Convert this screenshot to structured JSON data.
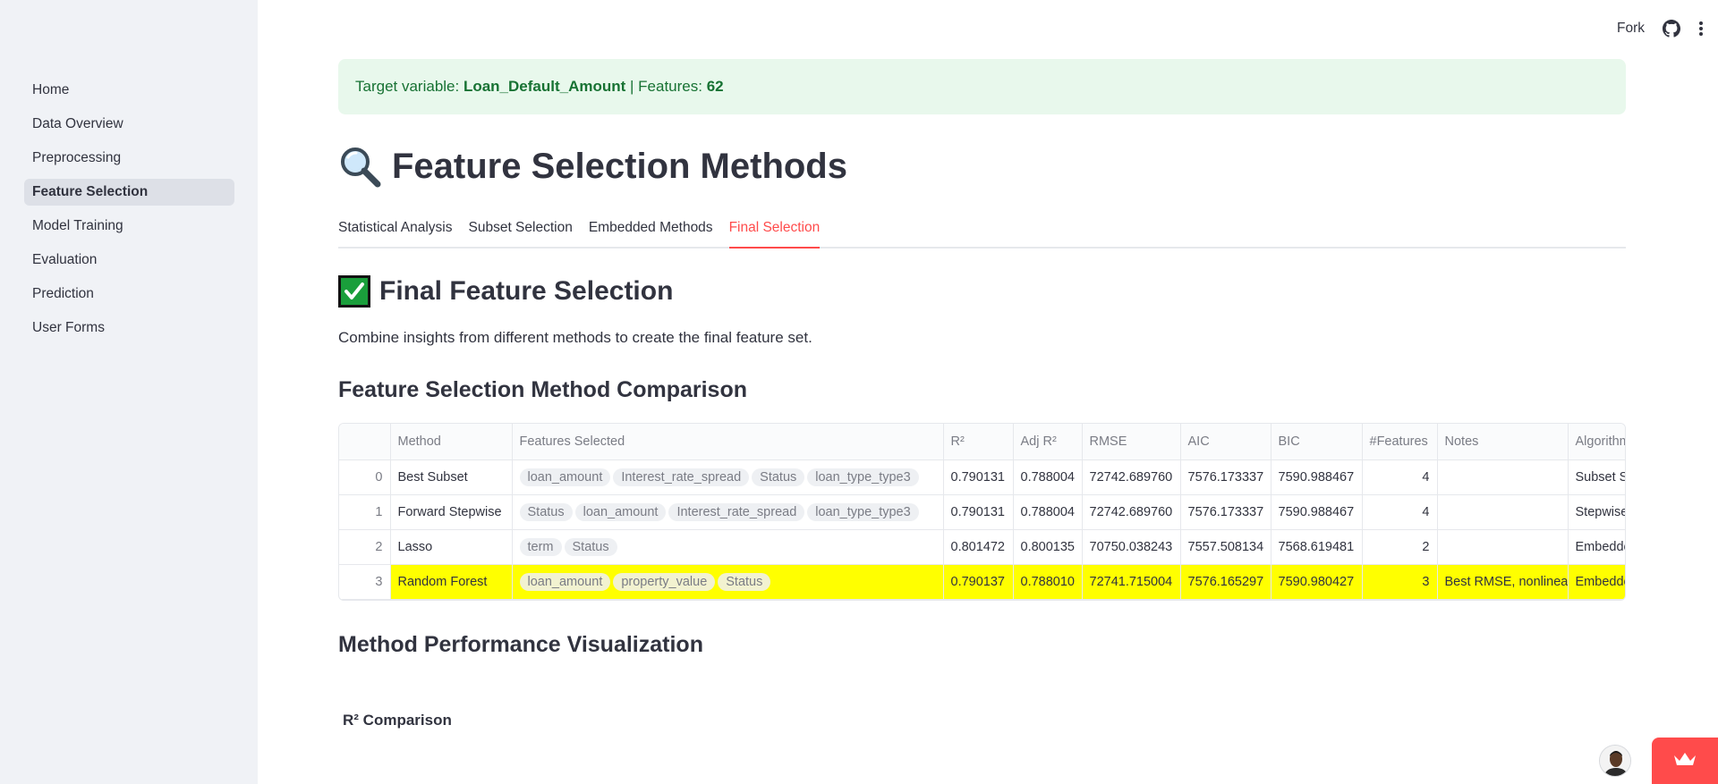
{
  "sidebar": {
    "items": [
      {
        "label": "Home",
        "active": false
      },
      {
        "label": "Data Overview",
        "active": false
      },
      {
        "label": "Preprocessing",
        "active": false
      },
      {
        "label": "Feature Selection",
        "active": true
      },
      {
        "label": "Model Training",
        "active": false
      },
      {
        "label": "Evaluation",
        "active": false
      },
      {
        "label": "Prediction",
        "active": false
      },
      {
        "label": "User Forms",
        "active": false
      }
    ]
  },
  "header": {
    "fork_label": "Fork",
    "icons": [
      "github-icon",
      "kebab-menu-icon"
    ]
  },
  "alert": {
    "prefix": "Target variable: ",
    "target": "Loan_Default_Amount",
    "separator": " | Features: ",
    "features_count": "62",
    "color": "#177233"
  },
  "page": {
    "title": "Feature Selection Methods",
    "title_icon": "magnifier-icon"
  },
  "tabs": [
    {
      "label": "Statistical Analysis",
      "active": false
    },
    {
      "label": "Subset Selection",
      "active": false
    },
    {
      "label": "Embedded Methods",
      "active": false
    },
    {
      "label": "Final Selection",
      "active": true
    }
  ],
  "section": {
    "title": "Final Feature Selection",
    "title_icon": "check-mark-icon",
    "description": "Combine insights from different methods to create the final feature set.",
    "comparison_title": "Feature Selection Method Comparison",
    "viz_title": "Method Performance Visualization",
    "r2_title": "R² Comparison"
  },
  "table": {
    "columns": [
      "",
      "Method",
      "Features Selected",
      "R²",
      "Adj R²",
      "RMSE",
      "AIC",
      "BIC",
      "#Features",
      "Notes",
      "Algorithm"
    ],
    "rows": [
      {
        "idx": "0",
        "method": "Best Subset",
        "features": [
          "loan_amount",
          "Interest_rate_spread",
          "Status",
          "loan_type_type3"
        ],
        "r2": "0.790131",
        "adj_r2": "0.788004",
        "rmse": "72742.689760",
        "aic": "7576.173337",
        "bic": "7590.988467",
        "n_features": "4",
        "notes": "",
        "algorithm": "Subset S",
        "highlight": false
      },
      {
        "idx": "1",
        "method": "Forward Stepwise",
        "features": [
          "Status",
          "loan_amount",
          "Interest_rate_spread",
          "loan_type_type3"
        ],
        "r2": "0.790131",
        "adj_r2": "0.788004",
        "rmse": "72742.689760",
        "aic": "7576.173337",
        "bic": "7590.988467",
        "n_features": "4",
        "notes": "",
        "algorithm": "Stepwise",
        "highlight": false
      },
      {
        "idx": "2",
        "method": "Lasso",
        "features": [
          "term",
          "Status"
        ],
        "r2": "0.801472",
        "adj_r2": "0.800135",
        "rmse": "70750.038243",
        "aic": "7557.508134",
        "bic": "7568.619481",
        "n_features": "2",
        "notes": "",
        "algorithm": "Embedde",
        "highlight": false
      },
      {
        "idx": "3",
        "method": "Random Forest",
        "features": [
          "loan_amount",
          "property_value",
          "Status"
        ],
        "r2": "0.790137",
        "adj_r2": "0.788010",
        "rmse": "72741.715004",
        "aic": "7576.165297",
        "bic": "7590.980427",
        "n_features": "3",
        "notes": "Best RMSE, nonlinear",
        "algorithm": "Embedde",
        "highlight": true
      }
    ],
    "highlight_color": "#ffff00"
  },
  "widgets": {
    "avatar_icon": "creator-avatar-icon",
    "crown_icon": "crown-icon",
    "accent": "#ff4b4b"
  }
}
